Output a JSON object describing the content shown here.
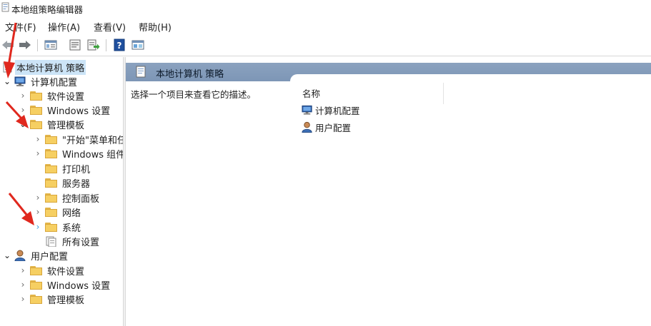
{
  "window": {
    "title": "本地组策略编辑器"
  },
  "menu": [
    "文件(F)",
    "操作(A)",
    "查看(V)",
    "帮助(H)"
  ],
  "toolbar": {
    "buttons": [
      "back-icon",
      "forward-icon",
      "show-hide-tree-icon",
      "properties-icon",
      "export-list-icon",
      "help-icon",
      "view-icon"
    ]
  },
  "tree": {
    "root": "本地计算机 策略",
    "computer": {
      "label": "计算机配置",
      "software": "软件设置",
      "windows": "Windows 设置",
      "admin_templates": {
        "label": "管理模板",
        "start_menu": "\"开始\"菜单和任务栏",
        "windows_components": "Windows 组件",
        "printers": "打印机",
        "server": "服务器",
        "control_panel": "控制面板",
        "network": "网络",
        "system": "系统",
        "all_settings": "所有设置"
      }
    },
    "user": {
      "label": "用户配置",
      "software": "软件设置",
      "windows": "Windows 设置",
      "admin_templates": "管理模板"
    }
  },
  "content": {
    "header": "本地计算机 策略",
    "description": "选择一个项目来查看它的描述。",
    "column_name": "名称",
    "items": [
      "计算机配置",
      "用户配置"
    ]
  },
  "colors": {
    "header_band": "#7d96b6",
    "selection": "#cce4f7",
    "folder": "#f6cf62",
    "annotation_arrow": "#e0281e"
  }
}
